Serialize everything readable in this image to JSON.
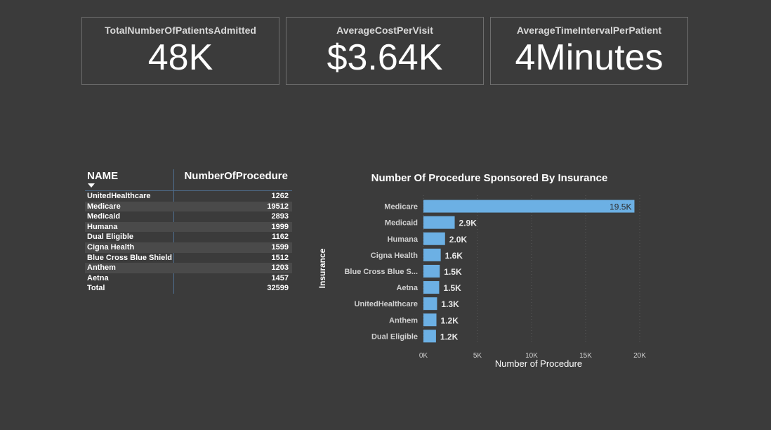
{
  "kpis": [
    {
      "title": "TotalNumberOfPatientsAdmitted",
      "value": "48K"
    },
    {
      "title": "AverageCostPerVisit",
      "value": "$3.64K"
    },
    {
      "title": "AverageTimeIntervalPerPatient",
      "value": "4Minutes"
    }
  ],
  "table": {
    "col_name": "NAME",
    "col_count": "NumberOfProcedure",
    "rows": [
      {
        "name": "UnitedHealthcare",
        "value": "1262"
      },
      {
        "name": "Medicare",
        "value": "19512"
      },
      {
        "name": "Medicaid",
        "value": "2893"
      },
      {
        "name": "Humana",
        "value": "1999"
      },
      {
        "name": "Dual Eligible",
        "value": "1162"
      },
      {
        "name": "Cigna Health",
        "value": "1599"
      },
      {
        "name": "Blue Cross Blue Shield",
        "value": "1512"
      },
      {
        "name": "Anthem",
        "value": "1203"
      },
      {
        "name": "Aetna",
        "value": "1457"
      }
    ],
    "total_label": "Total",
    "total_value": "32599"
  },
  "chart_data": {
    "type": "bar",
    "orientation": "horizontal",
    "title": "Number Of Procedure Sponsored By Insurance",
    "xlabel": "Number of Procedure",
    "ylabel": "Insurance",
    "categories": [
      "Medicare",
      "Medicaid",
      "Humana",
      "Cigna Health",
      "Blue Cross Blue S...",
      "Aetna",
      "UnitedHealthcare",
      "Anthem",
      "Dual Eligible"
    ],
    "values": [
      19512,
      2893,
      1999,
      1599,
      1512,
      1457,
      1262,
      1203,
      1162
    ],
    "data_labels": [
      "19.5K",
      "2.9K",
      "2.0K",
      "1.6K",
      "1.5K",
      "1.5K",
      "1.3K",
      "1.2K",
      "1.2K"
    ],
    "xticks": [
      "0K",
      "5K",
      "10K",
      "15K",
      "20K"
    ],
    "xlim": [
      0,
      20000
    ],
    "grid": true,
    "bar_color": "#6cb0e4",
    "background": "#3b3b3b"
  }
}
